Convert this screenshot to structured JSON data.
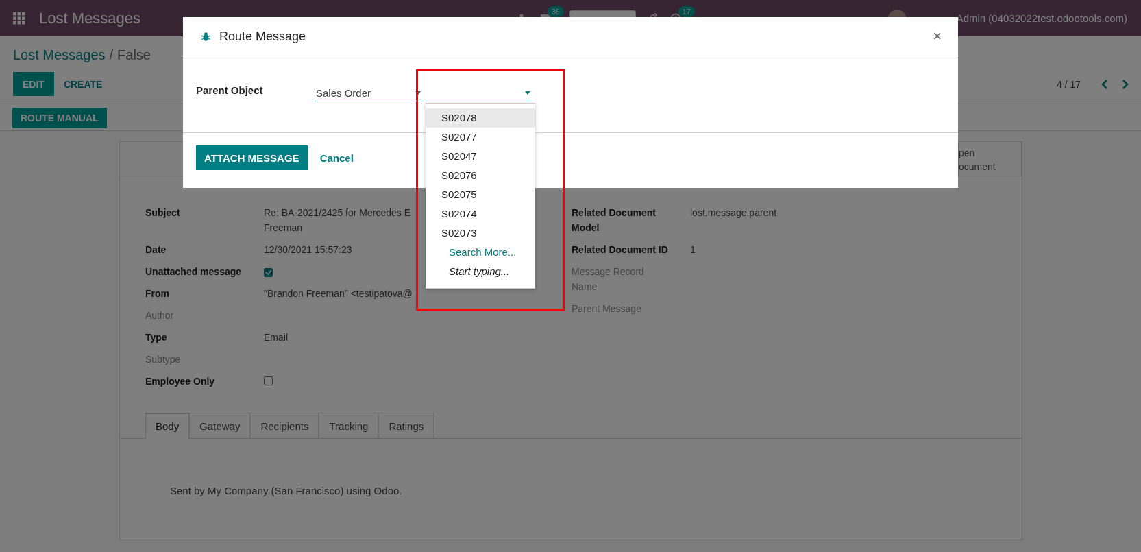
{
  "navbar": {
    "app_title": "Lost Messages",
    "chat_badge": "36",
    "activity_badge": "17",
    "user": "Admin (04032022test.odootools.com)"
  },
  "control_panel": {
    "breadcrumb": {
      "parent": "Lost Messages",
      "separator": "/",
      "current": "False"
    },
    "buttons": [
      {
        "label": "EDIT",
        "kind": "primary"
      },
      {
        "label": "CREATE",
        "kind": "secondary"
      }
    ],
    "pager": "4 / 17"
  },
  "status_bar": {
    "buttons": [
      "ROUTE MANUAL"
    ]
  },
  "sheet": {
    "smart_button": "pen\nocument",
    "left_fields": [
      {
        "label": "Subject",
        "kind": "text",
        "muted": false,
        "value": "Re: BA-2021/2425 for Mercedes E\nFreeman"
      },
      {
        "label": "Date",
        "kind": "text",
        "muted": false,
        "value": "12/30/2021 15:57:23"
      },
      {
        "label": "Unattached message",
        "kind": "checkbox",
        "muted": false,
        "checked": true
      },
      {
        "label": "From",
        "kind": "text",
        "muted": false,
        "value": "\"Brandon Freeman\" <testipatova@"
      },
      {
        "label": "Author",
        "kind": "text",
        "muted": true
      },
      {
        "label": "Type",
        "kind": "text",
        "muted": false,
        "value": "Email"
      },
      {
        "label": "Subtype",
        "kind": "text",
        "muted": true
      },
      {
        "label": "Employee Only",
        "kind": "checkbox",
        "muted": false,
        "checked": false
      }
    ],
    "right_fields": [
      {
        "label": "Related Document\nModel",
        "kind": "text",
        "muted": false,
        "value": "lost.message.parent"
      },
      {
        "label": "Related Document ID",
        "kind": "text",
        "muted": false,
        "value": "1"
      },
      {
        "label": "Message Record\nName",
        "kind": "text",
        "muted": true
      },
      {
        "label": "Parent Message",
        "kind": "text",
        "muted": true
      }
    ],
    "tabs": [
      {
        "label": "Body",
        "selected": true
      },
      {
        "label": "Gateway",
        "selected": false
      },
      {
        "label": "Recipients",
        "selected": false
      },
      {
        "label": "Tracking",
        "selected": false
      },
      {
        "label": "Ratings",
        "selected": false
      }
    ],
    "body": "Sent by My Company (San Francisco) using Odoo."
  },
  "dialog": {
    "title": "Route Message",
    "close": "×",
    "field_label": "Parent Object",
    "model": "Sales Order",
    "dropdown": {
      "items": [
        {
          "label": "S02078",
          "selected": true
        },
        {
          "label": "S02077",
          "selected": false
        },
        {
          "label": "S02047",
          "selected": false
        },
        {
          "label": "S02076",
          "selected": false
        },
        {
          "label": "S02075",
          "selected": false
        },
        {
          "label": "S02074",
          "selected": false
        },
        {
          "label": "S02073",
          "selected": false
        }
      ],
      "search_more": "Search More...",
      "hint": "Start typing..."
    },
    "buttons": [
      {
        "label": "ATTACH MESSAGE",
        "kind": "primary"
      },
      {
        "label": "Cancel",
        "kind": "link"
      }
    ]
  }
}
